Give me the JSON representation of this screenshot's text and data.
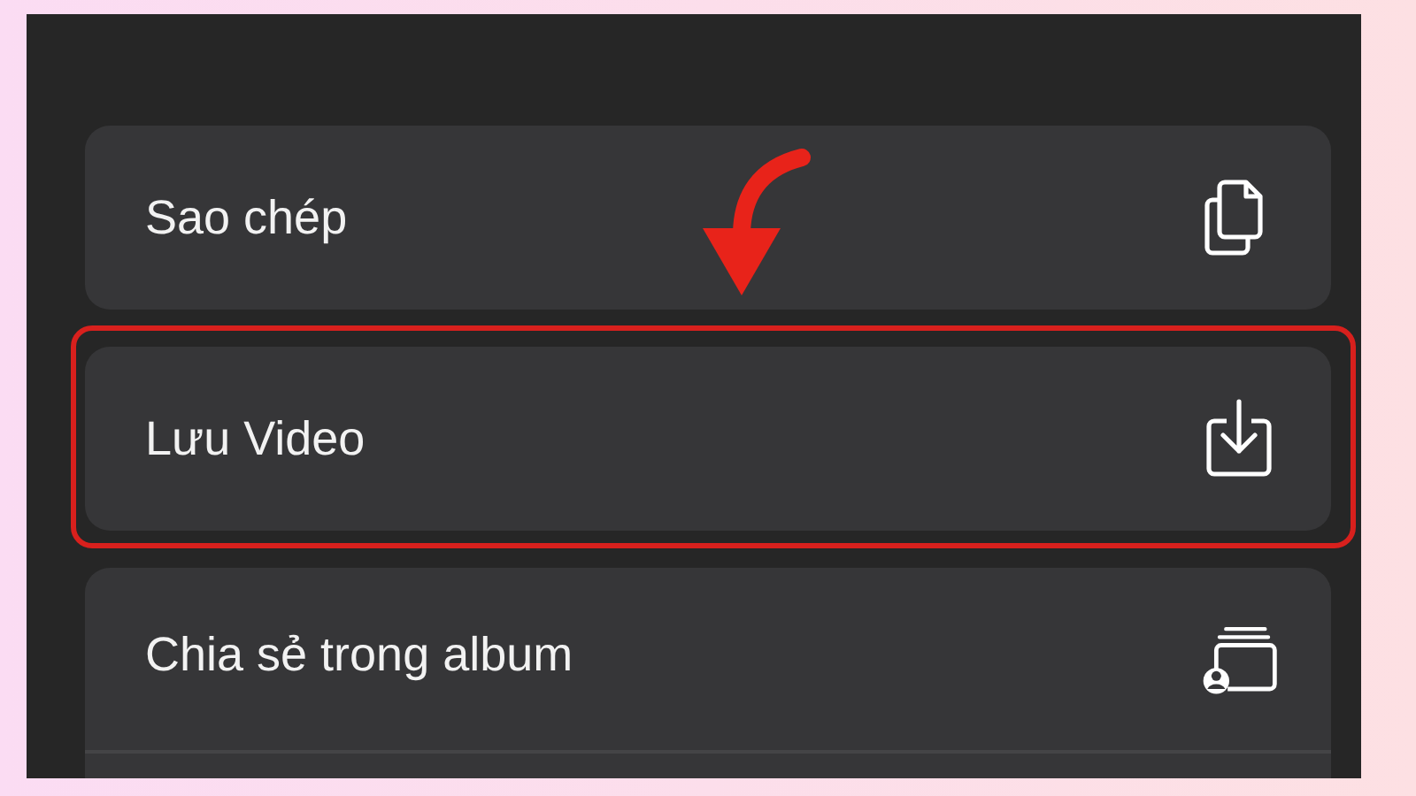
{
  "actions": [
    {
      "label": "Sao chép",
      "kind": "copy",
      "highlighted": false
    },
    {
      "label": "Lưu Video",
      "kind": "save",
      "highlighted": true
    },
    {
      "label": "Chia sẻ trong album",
      "kind": "shared-album",
      "highlighted": false
    }
  ]
}
